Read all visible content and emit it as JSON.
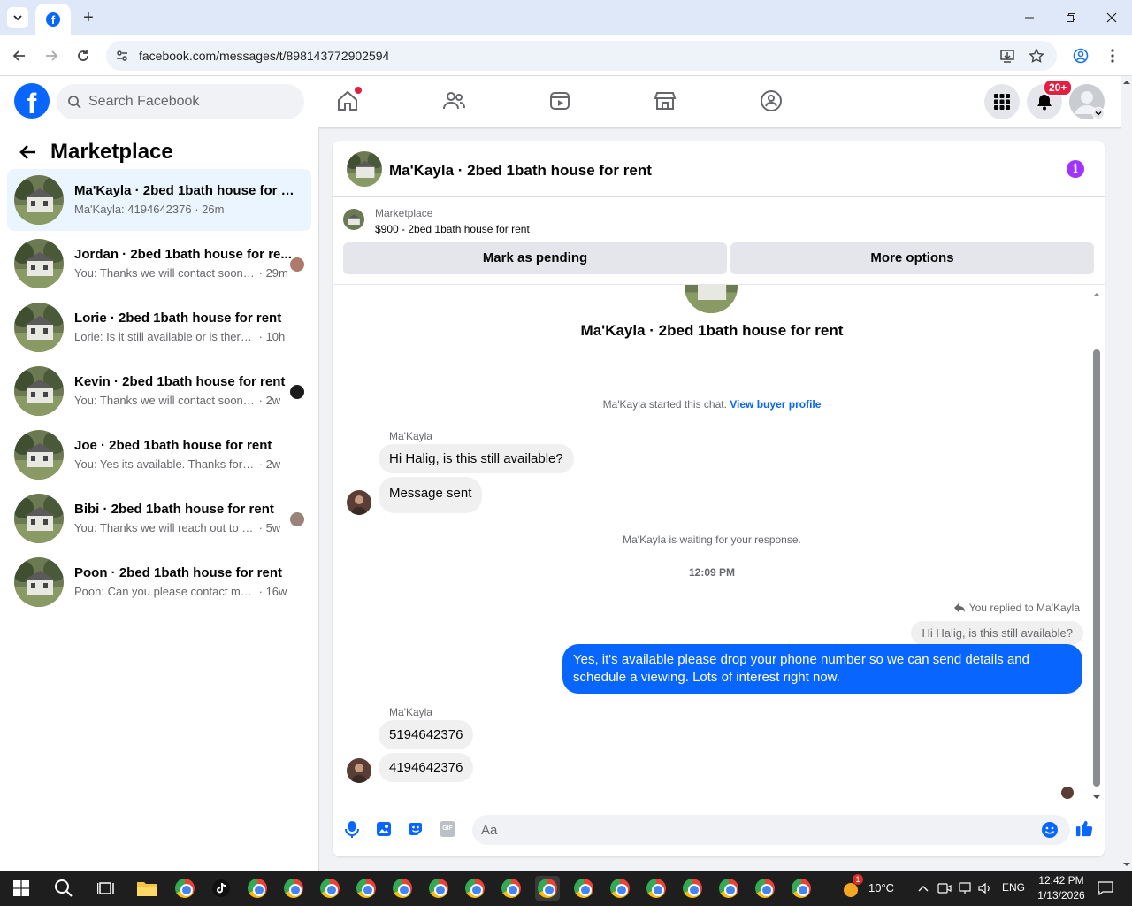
{
  "browser": {
    "url": "facebook.com/messages/t/898143772902594"
  },
  "fbnav": {
    "search_placeholder": "Search Facebook",
    "notif_badge": "20+"
  },
  "sidebar": {
    "title": "Marketplace",
    "conversations": [
      {
        "name": "Ma'Kayla · 2bed 1bath house for re...",
        "preview": "Ma'Kayla: 4194642376",
        "time": "· 26m",
        "active": true
      },
      {
        "name": "Jordan · 2bed 1bath house for re...",
        "preview": "You: Thanks we will contact soon ...",
        "time": "· 29m"
      },
      {
        "name": "Lorie · 2bed 1bath house for rent",
        "preview": "Lorie: Is it still available or is there so...",
        "time": "· 10h"
      },
      {
        "name": "Kevin · 2bed 1bath house for rent",
        "preview": "You: Thanks we will contact soon ...",
        "time": "· 2w"
      },
      {
        "name": "Joe · 2bed 1bath house for rent",
        "preview": "You: Yes its available. Thanks for reach...",
        "time": "· 2w"
      },
      {
        "name": "Bibi · 2bed 1bath house for rent",
        "preview": "You: Thanks we will reach out to y...",
        "time": "· 5w"
      },
      {
        "name": "Poon · 2bed 1bath house for rent",
        "preview": "Poon: Can you please contact me at ...",
        "time": "· 16w"
      }
    ]
  },
  "chat": {
    "title": "Ma'Kayla · 2bed 1bath house for rent",
    "listing_label": "Marketplace",
    "listing_price": "$900 - 2bed 1bath house for rent",
    "mark_pending": "Mark as pending",
    "more_options": "More options",
    "intro_title": "Ma'Kayla · 2bed 1bath house for rent",
    "started_text": "Ma'Kayla started this chat.",
    "view_profile": "View buyer profile",
    "sender1": "Ma'Kayla",
    "msg1": "Hi Halig, is this still available?",
    "msg2": "Message sent",
    "waiting": "Ma'Kayla is waiting for your response.",
    "time": "12:09 PM",
    "replied_to": "You replied to Ma'Kayla",
    "quoted": "Hi Halig, is this still available?",
    "my_msg": "Yes, it's available please drop your phone number so we can send details and schedule a viewing. Lots of interest right now.",
    "sender2": "Ma'Kayla",
    "msg3": "5194642376",
    "msg4": "4194642376",
    "composer_placeholder": "Aa"
  },
  "taskbar": {
    "temp": "10°C",
    "lang": "ENG",
    "clock_time": "12:42 PM",
    "clock_date": "1/13/2026",
    "weather_badge": "1"
  },
  "colors": {
    "fb_blue": "#0866ff",
    "active_conv": "#ebf5ff",
    "info": "#a033ff"
  }
}
